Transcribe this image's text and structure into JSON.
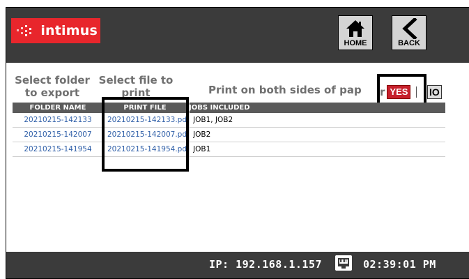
{
  "header": {
    "logo_text": "intimus",
    "home_label": "HOME",
    "back_label": "BACK"
  },
  "steps": {
    "select_folder": "Select folder to export",
    "select_file": "Select file to print"
  },
  "duplex": {
    "label": "Print on both sides of pap",
    "label_tail": "r",
    "yes": "YES",
    "no": "IO"
  },
  "table": {
    "headers": [
      "FOLDER NAME",
      "PRINT FILE",
      "JOBS INCLUDED"
    ],
    "rows": [
      {
        "folder": "20210215-142133",
        "file": "20210215-142133.pd",
        "jobs": "JOB1, JOB2"
      },
      {
        "folder": "20210215-142007",
        "file": "20210215-142007.pd",
        "jobs": "JOB2"
      },
      {
        "folder": "20210215-141954",
        "file": "20210215-141954.pd",
        "jobs": "JOB1"
      }
    ]
  },
  "footer": {
    "ip": "IP: 192.168.1.157",
    "time": "02:39:01 PM"
  },
  "colors": {
    "brand_red": "#e8262c",
    "dark_bar": "#3b3b3b",
    "link_blue": "#2f5fa8",
    "toggle_red": "#c7202c"
  }
}
